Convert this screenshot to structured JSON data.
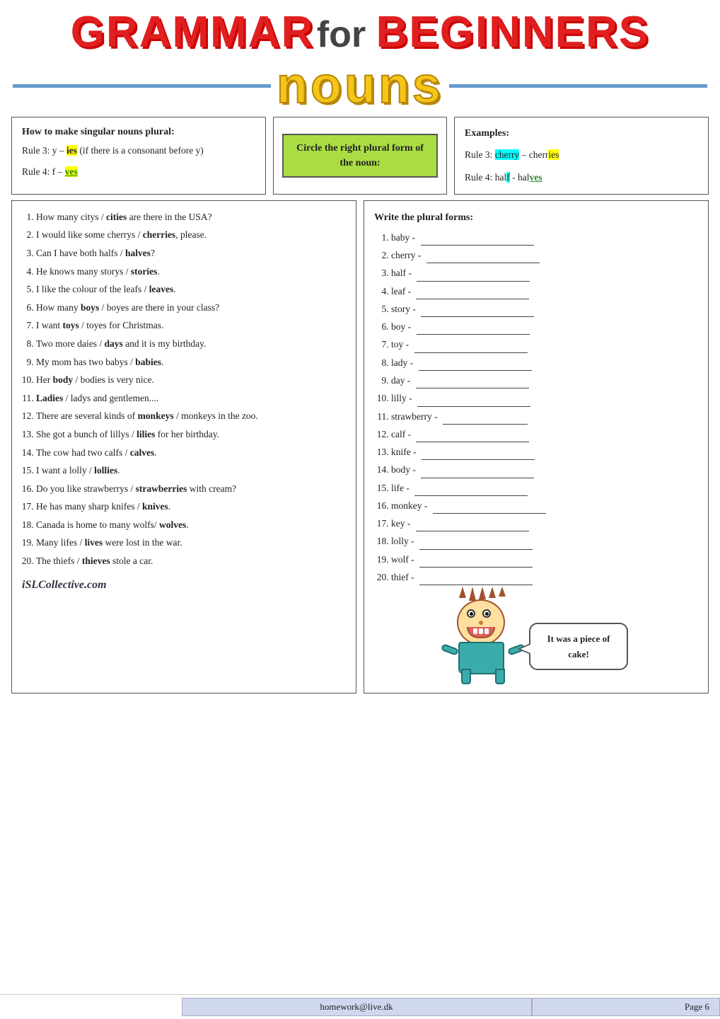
{
  "header": {
    "title_grammar": "GRAMMAR",
    "title_for": "for",
    "title_beginners": "BEGINNERS",
    "subtitle": "nouns"
  },
  "rules": {
    "title": "How to make singular nouns plural:",
    "rule3": "Rule 3: y –",
    "rule3_ies": "ies",
    "rule3_note": "(if there is a consonant before y)",
    "rule4": "Rule 4: f –",
    "rule4_ves": "ves"
  },
  "circle_box": {
    "text": "Circle the right plural form of the noun:"
  },
  "examples": {
    "title": "Examples:",
    "rule3_text": "Rule 3: cherry – cherries",
    "rule4_text": "Rule 4: half - halves"
  },
  "exercise_left": {
    "items": [
      "How many citys / cities are there in the USA?",
      "I would like some cherrys / cherries, please.",
      "Can I have both halfs / halves?",
      "He knows many storys / stories.",
      "I like the colour of the leafs / leaves.",
      "How many boys / boyes are there in your class?",
      "I want toys / toyes for Christmas.",
      "Two more daies / days and it is my birthday.",
      "My mom has two babys / babies.",
      "Her body / bodies is very nice.",
      "Ladies / ladys and gentlemen....",
      "There are several kinds of monkeys / monkeys in the zoo.",
      "She got a bunch of lillys / lilies for her birthday.",
      "The cow had two calfs / calves.",
      "I want a lolly / lollies.",
      "Do you like strawberrys / strawberries with cream?",
      "He has many sharp knifes / knives.",
      "Canada is home to many wolfs/ wolves.",
      "Many lifes / lives were lost in the war.",
      "The thiefs / thieves stole a car."
    ]
  },
  "exercise_right": {
    "title": "Write the plural forms:",
    "items": [
      "baby -",
      "cherry -",
      "half -",
      "leaf -",
      "story -",
      "boy -",
      "toy -",
      "lady -",
      "day -",
      "lilly -",
      "strawberry -",
      "calf -",
      "knife -",
      "body -",
      "life -",
      "monkey -",
      "key -",
      "lolly -",
      "wolf -",
      "thief -"
    ]
  },
  "speech_bubble": {
    "text": "It was a piece of cake!"
  },
  "footer": {
    "watermark": "iSLCollective.com",
    "email": "homework@live.dk",
    "page": "Page 6"
  }
}
